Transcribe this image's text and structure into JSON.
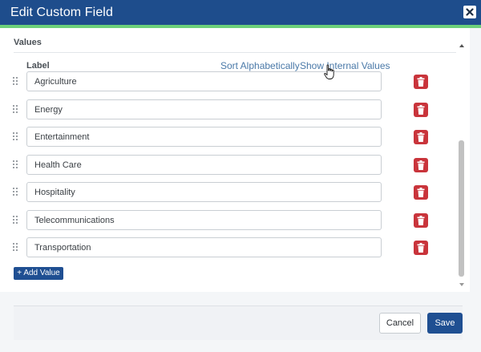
{
  "dialog": {
    "title": "Edit Custom Field"
  },
  "values_section": {
    "title": "Values",
    "column_label": "Label",
    "sort_link": "Sort Alphabetically",
    "internal_link": "Show Internal Values",
    "items": [
      {
        "label": "Agriculture"
      },
      {
        "label": "Energy"
      },
      {
        "label": "Entertainment"
      },
      {
        "label": "Health Care"
      },
      {
        "label": "Hospitality"
      },
      {
        "label": "Telecommunications"
      },
      {
        "label": "Transportation"
      }
    ],
    "add_label": "+ Add Value"
  },
  "footer": {
    "cancel_label": "Cancel",
    "save_label": "Save"
  },
  "colors": {
    "titlebar": "#1e4d8c",
    "accent_bar": "#6cd07a",
    "primary_button": "#1f4f92",
    "delete_button": "#c9343b",
    "link": "#4a79a8"
  },
  "icons": {
    "close": "close-icon",
    "drag": "drag-handle-icon",
    "delete": "trash-icon",
    "scroll_up": "scroll-up-icon",
    "scroll_down": "scroll-down-icon"
  }
}
